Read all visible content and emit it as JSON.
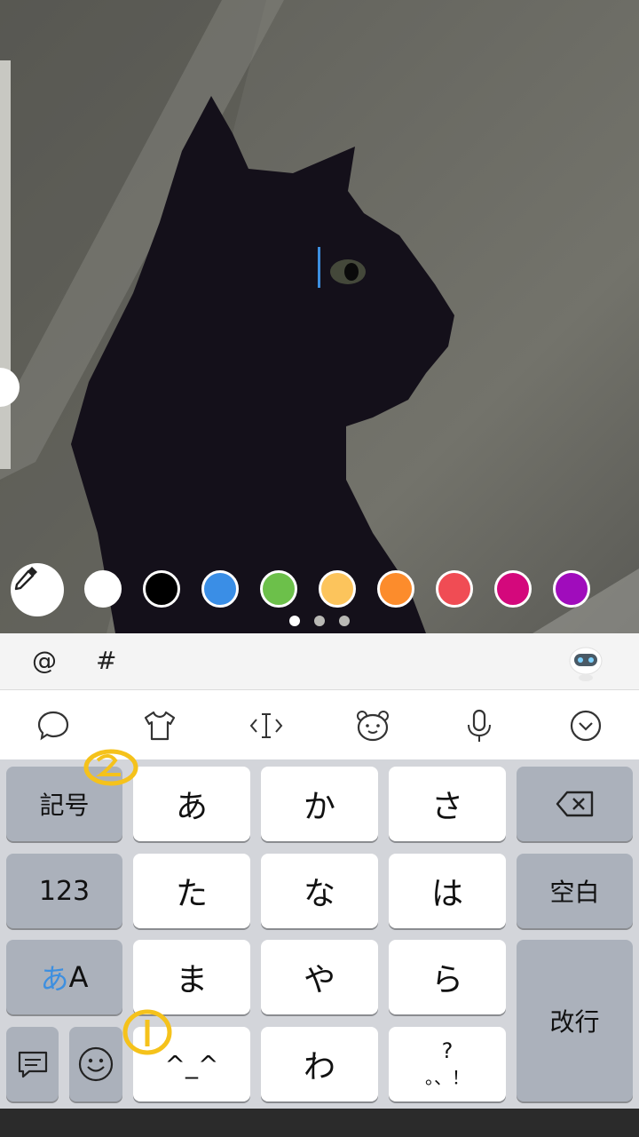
{
  "palette": {
    "colors": [
      "#ffffff",
      "#000000",
      "#3a8ee6",
      "#6cc04a",
      "#fcc45c",
      "#fc8c2c",
      "#f04c54",
      "#d4087c",
      "#a00cbc"
    ],
    "active_page": 0,
    "page_count": 3
  },
  "suggestion_bar": {
    "at": "@",
    "hash": "#"
  },
  "toolbar": {
    "icons": [
      "speech-bubble-icon",
      "tshirt-icon",
      "cursor-move-icon",
      "bear-face-icon",
      "microphone-icon",
      "chevron-down-circle-icon"
    ]
  },
  "keyboard": {
    "symbols": "記号",
    "numbers": "123",
    "kana_a": "あ",
    "latin_a": "A",
    "space": "空白",
    "enter": "改行",
    "rows": [
      [
        "あ",
        "か",
        "さ"
      ],
      [
        "た",
        "な",
        "は"
      ],
      [
        "ま",
        "や",
        "ら"
      ]
    ],
    "kaomoji": "^_^",
    "wa": "わ",
    "punct_top": "?",
    "punct_bottom": "。、！"
  },
  "annotations": [
    "①",
    "②"
  ]
}
